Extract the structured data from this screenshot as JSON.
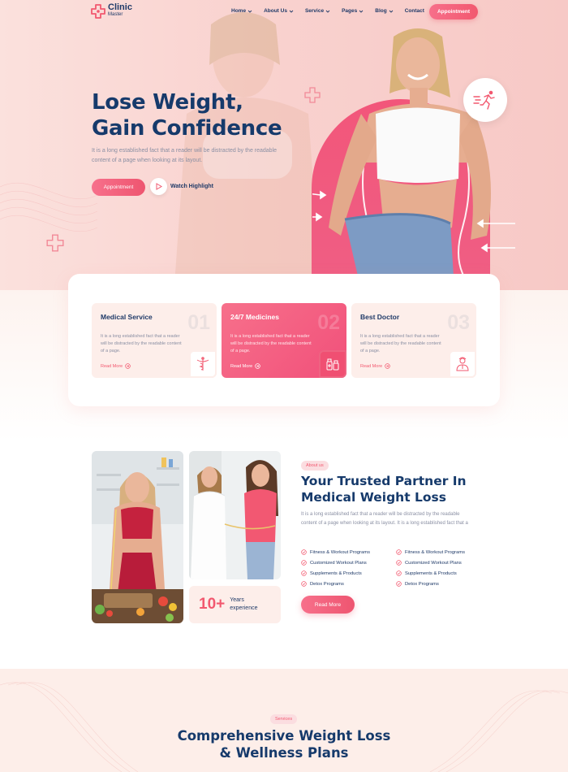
{
  "brand": {
    "name": "Clinic",
    "tagline": "Master",
    "accent": "#f2586f",
    "navy": "#163a6b"
  },
  "nav": {
    "items": [
      {
        "label": "Home",
        "dropdown": true
      },
      {
        "label": "About Us",
        "dropdown": true
      },
      {
        "label": "Service",
        "dropdown": true
      },
      {
        "label": "Pages",
        "dropdown": true
      },
      {
        "label": "Blog",
        "dropdown": true
      },
      {
        "label": "Contact",
        "dropdown": false
      }
    ],
    "cta": "Appointment"
  },
  "hero": {
    "title_line1": "Lose Weight,",
    "title_line2": "Gain Confidence",
    "description": "It is a long established fact that a reader will be distracted by the readable content of a page when looking at its layout.",
    "primary_button": "Appointment",
    "secondary_button": "Watch Highlight"
  },
  "services_cards": [
    {
      "title": "Medical Service",
      "number": "01",
      "description": "It is a long established fact that a reader will be distracted by the readable content of a page.",
      "link": "Read More",
      "icon": "caduceus-icon",
      "active": false
    },
    {
      "title": "24/7 Medicines",
      "number": "02",
      "description": "It is a long established fact that a reader will be distracted by the readable content of a page.",
      "link": "Read More",
      "icon": "medicine-bottles-icon",
      "active": true
    },
    {
      "title": "Best Doctor",
      "number": "03",
      "description": "It is a long established fact that a reader will be distracted by the readable content of a page.",
      "link": "Read More",
      "icon": "doctor-icon",
      "active": false
    }
  ],
  "about": {
    "pill": "About us",
    "title": "Your Trusted Partner In Medical Weight Loss",
    "description": "It is a long established fact that a reader will be distracted by the readable content of a page when looking at its layout. It is a long established fact that a",
    "checklist_left": [
      "Fitness & Workout Programs",
      "Customized Workout Plans",
      "Supplements & Products",
      "Detox Programs"
    ],
    "checklist_right": [
      "Fitness & Workout Programs",
      "Customized Workout Plans",
      "Supplements & Products",
      "Detox Programs"
    ],
    "button": "Read More",
    "experience_number": "10+",
    "experience_label": "Years experience"
  },
  "services_section": {
    "pill": "Services",
    "title_line1": "Comprehensive Weight Loss",
    "title_line2": "& Wellness Plans"
  }
}
